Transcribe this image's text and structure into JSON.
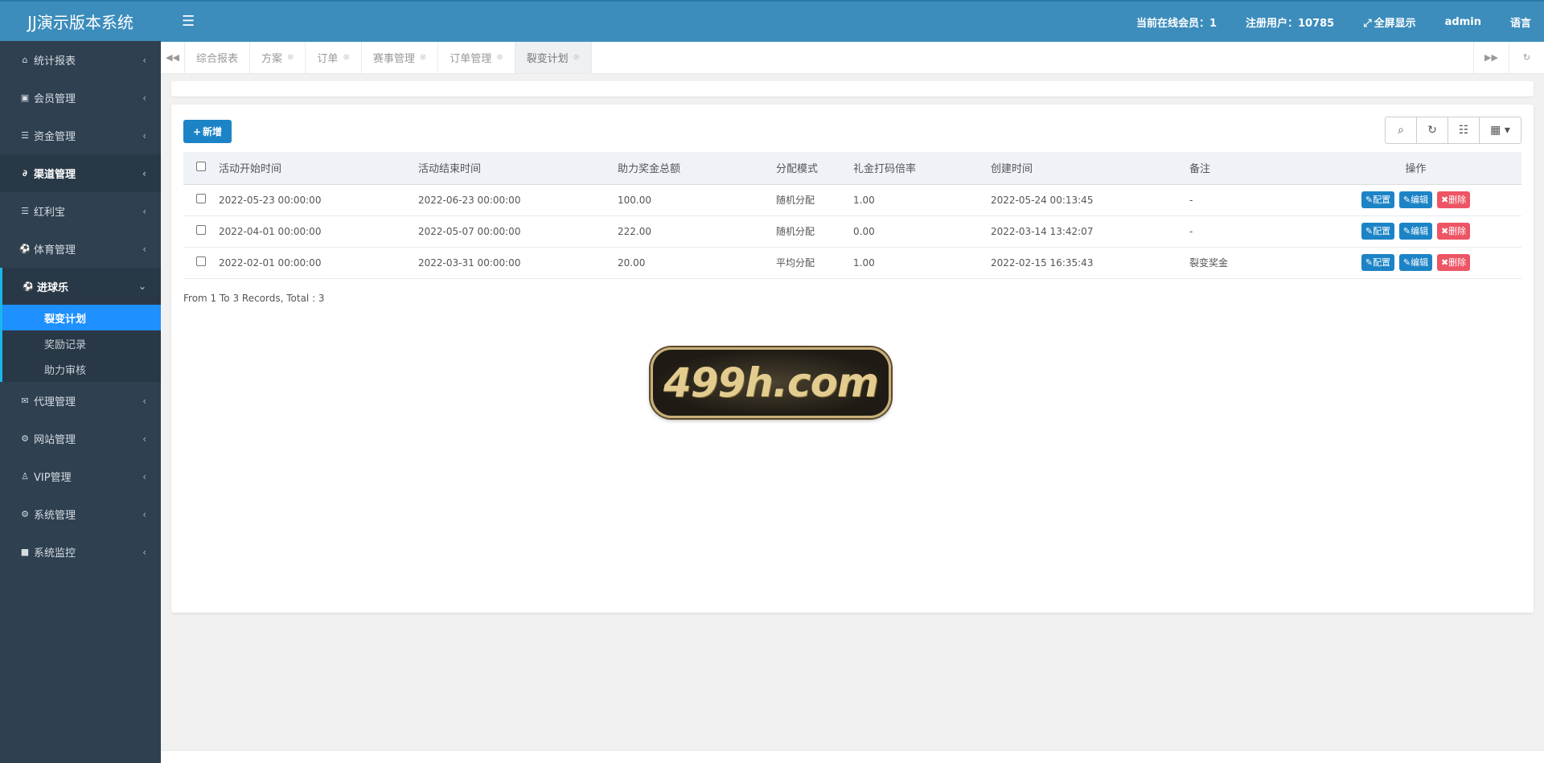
{
  "app": {
    "title": "JJ演示版本系统",
    "accent": "#3c8dbc",
    "sidebar_bg": "#2f4050"
  },
  "header": {
    "toggle_icon": "hamburger-icon",
    "online": "当前在线会员：1",
    "registered": "注册用户：10785",
    "fullscreen": "全屏显示",
    "user": "admin",
    "language": "语言"
  },
  "sidebar": {
    "items": [
      {
        "label": "统计报表",
        "icon": "home-icon"
      },
      {
        "label": "会员管理",
        "icon": "user-card-icon"
      },
      {
        "label": "资金管理",
        "icon": "database-icon"
      },
      {
        "label": "渠道管理",
        "icon": "link-icon"
      },
      {
        "label": "红利宝",
        "icon": "database-icon"
      },
      {
        "label": "体育管理",
        "icon": "soccer-ball-icon"
      },
      {
        "label": "进球乐",
        "icon": "soccer-ball-icon"
      },
      {
        "label": "代理管理",
        "icon": "envelope-icon"
      },
      {
        "label": "网站管理",
        "icon": "gears-icon"
      },
      {
        "label": "VIP管理",
        "icon": "user-icon"
      },
      {
        "label": "系统管理",
        "icon": "gear-icon"
      },
      {
        "label": "系统监控",
        "icon": "video-camera-icon"
      }
    ],
    "sub_items": [
      {
        "label": "裂变计划"
      },
      {
        "label": "奖励记录"
      },
      {
        "label": "助力审核"
      }
    ]
  },
  "tabs": [
    {
      "label": "综合报表"
    },
    {
      "label": "方案"
    },
    {
      "label": "订单"
    },
    {
      "label": "赛事管理"
    },
    {
      "label": "订单管理"
    },
    {
      "label": "裂变计划"
    }
  ],
  "toolbar": {
    "add_label": "新增"
  },
  "table": {
    "headers": [
      "活动开始时间",
      "活动结束时间",
      "助力奖金总额",
      "分配模式",
      "礼金打码倍率",
      "创建时间",
      "备注",
      "操作"
    ],
    "rows": [
      {
        "start": "2022-05-23 00:00:00",
        "end": "2022-06-23 00:00:00",
        "total": "100.00",
        "mode": "随机分配",
        "rate": "1.00",
        "created": "2022-05-24 00:13:45",
        "note": "-"
      },
      {
        "start": "2022-04-01 00:00:00",
        "end": "2022-05-07 00:00:00",
        "total": "222.00",
        "mode": "随机分配",
        "rate": "0.00",
        "created": "2022-03-14 13:42:07",
        "note": "-"
      },
      {
        "start": "2022-02-01 00:00:00",
        "end": "2022-03-31 00:00:00",
        "total": "20.00",
        "mode": "平均分配",
        "rate": "1.00",
        "created": "2022-02-15 16:35:43",
        "note": "裂变奖金"
      }
    ],
    "actions": {
      "config": "配置",
      "edit": "编辑",
      "delete": "删除"
    }
  },
  "pagination": {
    "summary": "From 1 To 3 Records, Total : 3"
  },
  "brand_logo": "499h.com"
}
